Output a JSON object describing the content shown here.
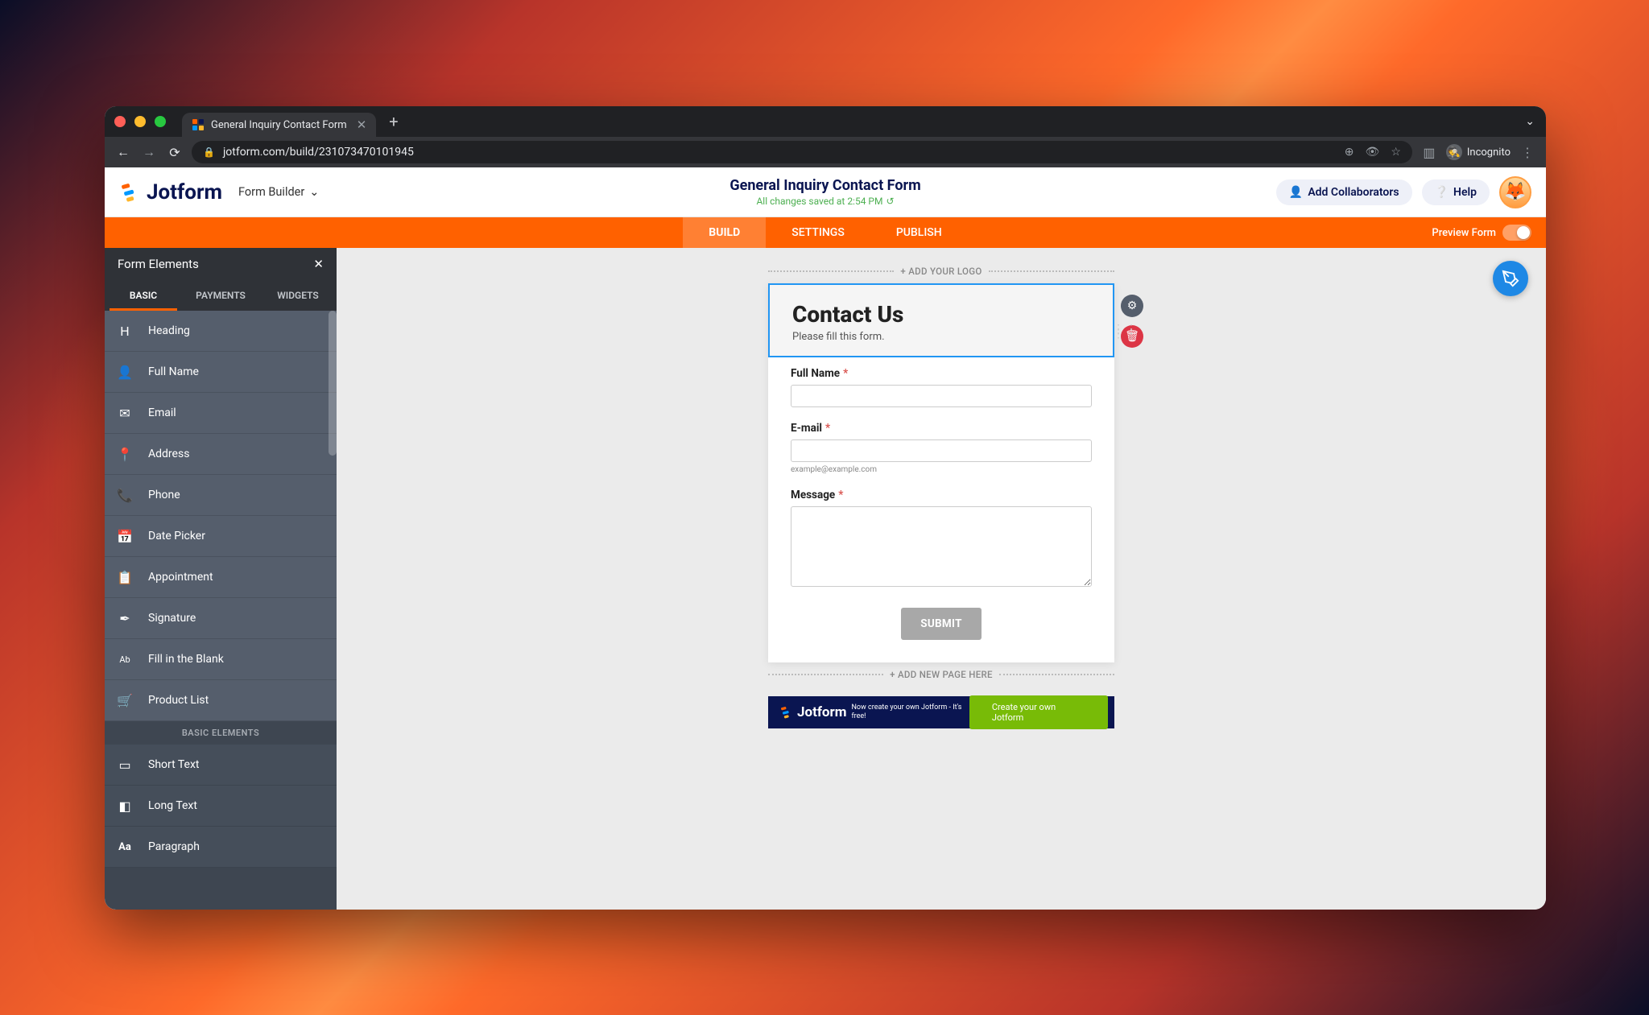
{
  "browser": {
    "tab_title": "General Inquiry Contact Form",
    "url": "jotform.com/build/231073470101945",
    "incognito_label": "Incognito"
  },
  "header": {
    "brand": "Jotform",
    "form_builder_label": "Form Builder",
    "form_title": "General Inquiry Contact Form",
    "save_status": "All changes saved at 2:54 PM",
    "add_collab": "Add Collaborators",
    "help": "Help"
  },
  "nav_tabs": {
    "build": "BUILD",
    "settings": "SETTINGS",
    "publish": "PUBLISH",
    "preview": "Preview Form"
  },
  "sidebar": {
    "title": "Form Elements",
    "tabs": {
      "basic": "BASIC",
      "payments": "PAYMENTS",
      "widgets": "WIDGETS"
    },
    "items": [
      {
        "label": "Heading",
        "icon": "H"
      },
      {
        "label": "Full Name",
        "icon": "👤"
      },
      {
        "label": "Email",
        "icon": "✉"
      },
      {
        "label": "Address",
        "icon": "📍"
      },
      {
        "label": "Phone",
        "icon": "📞"
      },
      {
        "label": "Date Picker",
        "icon": "📅"
      },
      {
        "label": "Appointment",
        "icon": "📋"
      },
      {
        "label": "Signature",
        "icon": "✒"
      },
      {
        "label": "Fill in the Blank",
        "icon": "Ab"
      },
      {
        "label": "Product List",
        "icon": "🛒"
      }
    ],
    "divider": "BASIC ELEMENTS",
    "items2": [
      {
        "label": "Short Text",
        "icon": "▭"
      },
      {
        "label": "Long Text",
        "icon": "◧"
      },
      {
        "label": "Paragraph",
        "icon": "Aa"
      }
    ]
  },
  "canvas": {
    "add_logo": "+ ADD YOUR LOGO",
    "add_page": "+ ADD NEW PAGE HERE",
    "form_heading": "Contact Us",
    "form_subtext": "Please fill this form.",
    "fields": {
      "full_name": "Full Name",
      "email": "E-mail",
      "email_hint": "example@example.com",
      "message": "Message"
    },
    "submit": "SUBMIT"
  },
  "promo": {
    "brand": "Jotform",
    "text": "Now create your own Jotform - It's free!",
    "cta": "Create your own Jotform"
  }
}
